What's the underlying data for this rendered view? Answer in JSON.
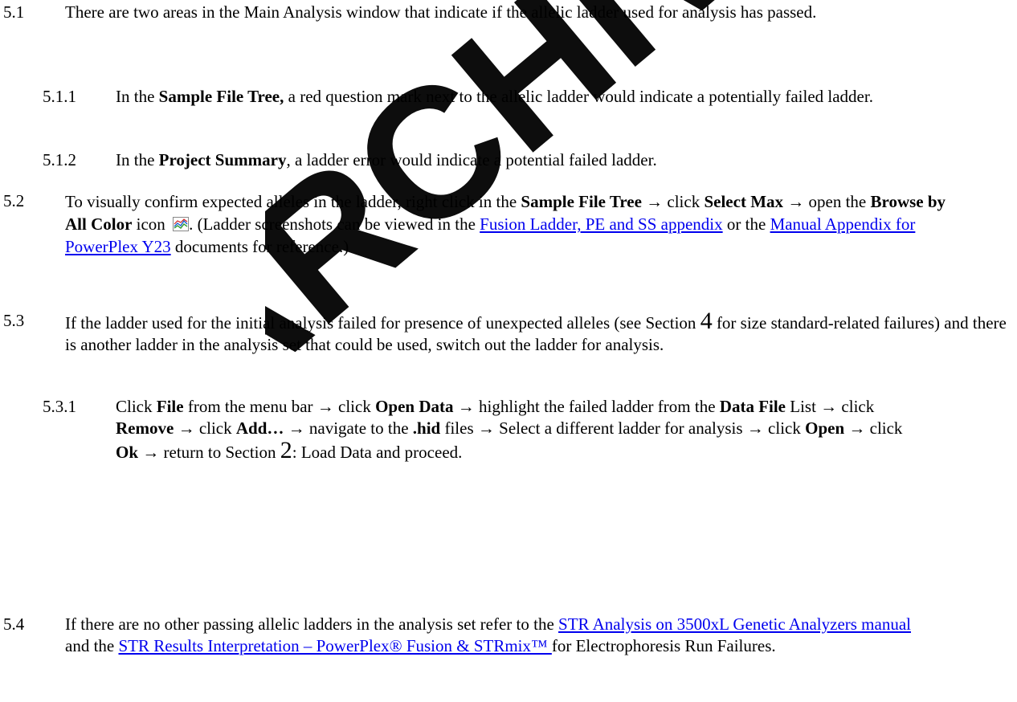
{
  "watermark": "ARCHIVED",
  "s51": {
    "num": "5.1",
    "text": "There are two areas in the Main Analysis window that indicate if the allelic ladder used for analysis has passed."
  },
  "s511": {
    "num": "5.1.1",
    "t1": "In the ",
    "b1": "Sample File Tree,",
    "t2": " a red question mark next to the allelic ladder would indicate a potentially failed ladder."
  },
  "s512": {
    "num": "5.1.2",
    "t1": "In the ",
    "b1": "Project Summary",
    "t2": ", a ladder error would indicate a potential failed ladder."
  },
  "s52": {
    "num": "5.2",
    "t1": "To visually confirm expected alleles in the ladder, right click in the ",
    "b1": "Sample File Tree",
    "t2": " → click ",
    "b2": "Select Max",
    "t3": " → open the ",
    "b3": "Browse by All Color",
    "t4": " icon ",
    "t5": ". (Ladder screenshots can be viewed in the ",
    "link1": "Fusion Ladder, PE and SS appendix",
    "t6": " or the ",
    "link2": "Manual Appendix for PowerPlex Y23",
    "t7": " documents for reference.)"
  },
  "s53": {
    "num": "5.3",
    "t1": "If the ladder used for the initial analysis failed for presence of unexpected alleles (see Section ",
    "sec": "4",
    "t2": " for size standard-related failures) and there is another ladder in the analysis set that could be used, switch out the ladder for analysis."
  },
  "s531": {
    "num": "5.3.1",
    "t1": "Click ",
    "b1": "File",
    "t2": " from the menu bar → click ",
    "b2": "Open Data",
    "t3": " → highlight the failed ladder from the ",
    "b3": "Data File",
    "t4": " List → click ",
    "b4": "Remove",
    "t5": " → click ",
    "b5": "Add…",
    "t6": " → navigate to the ",
    "b6": ".hid",
    "t7": " files → Select a different ladder for analysis → click ",
    "b7": "Open",
    "t8": " → click ",
    "b8": "Ok",
    "t9": " → return to Section ",
    "sec": "2",
    "t10": ": Load Data and proceed."
  },
  "s54": {
    "num": "5.4",
    "t1": "If there are no other passing allelic ladders in the analysis set refer to the ",
    "link1": "STR Analysis on 3500xL Genetic Analyzers manual ",
    "t2": " and the ",
    "link2": "STR Results Interpretation – PowerPlex® Fusion & STRmix™ ",
    "t3": " for Electrophoresis Run Failures."
  },
  "colors": {
    "link": "#0000ee",
    "watermark": "#000000"
  },
  "icons": [
    "chart-icon"
  ]
}
